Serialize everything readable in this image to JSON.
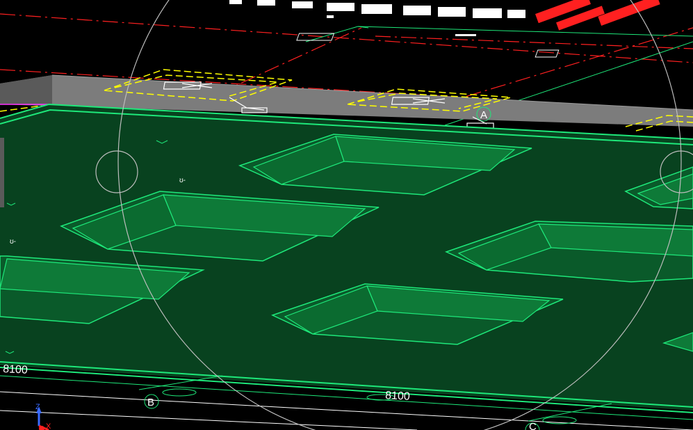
{
  "viewport": {
    "grid_labels": {
      "a": "A",
      "b": "B",
      "c": "C"
    },
    "dimensions": {
      "left": "8100",
      "bottom": "8100"
    },
    "axis": {
      "x": "X",
      "z": "Z"
    },
    "colors": {
      "background": "#000000",
      "slab": "#08421F",
      "slab_edge": "#1EE87A",
      "wall": "#808080",
      "grid_line": "#FF2020",
      "annotation": "#FFFF00",
      "text": "#FFFFFF"
    }
  }
}
